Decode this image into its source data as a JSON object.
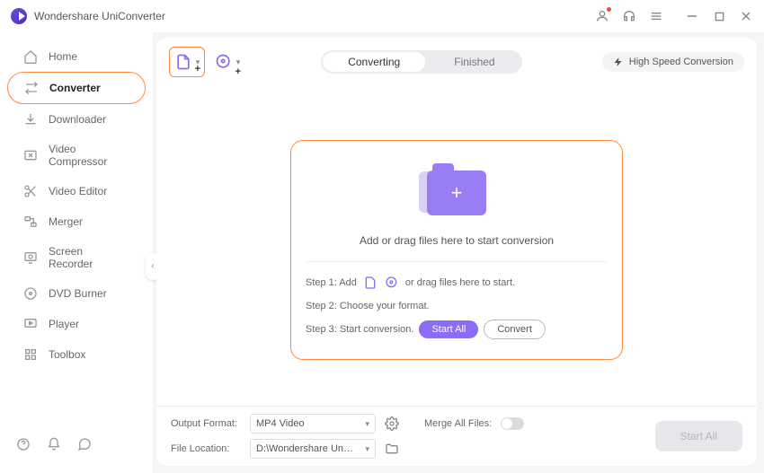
{
  "app": {
    "title": "Wondershare UniConverter"
  },
  "sidebar": {
    "items": [
      {
        "label": "Home"
      },
      {
        "label": "Converter"
      },
      {
        "label": "Downloader"
      },
      {
        "label": "Video Compressor"
      },
      {
        "label": "Video Editor"
      },
      {
        "label": "Merger"
      },
      {
        "label": "Screen Recorder"
      },
      {
        "label": "DVD Burner"
      },
      {
        "label": "Player"
      },
      {
        "label": "Toolbox"
      }
    ]
  },
  "tabs": {
    "converting": "Converting",
    "finished": "Finished"
  },
  "toolbar": {
    "high_speed": "High Speed Conversion"
  },
  "drop": {
    "main_text": "Add or drag files here to start conversion",
    "step1_prefix": "Step 1: Add",
    "step1_suffix": "or drag files here to start.",
    "step2": "Step 2: Choose your format.",
    "step3": "Step 3: Start conversion.",
    "start_all": "Start All",
    "convert": "Convert"
  },
  "bottom": {
    "output_format_label": "Output Format:",
    "output_format_value": "MP4 Video",
    "file_location_label": "File Location:",
    "file_location_value": "D:\\Wondershare UniConverter",
    "merge_label": "Merge All Files:",
    "start_all": "Start All"
  }
}
